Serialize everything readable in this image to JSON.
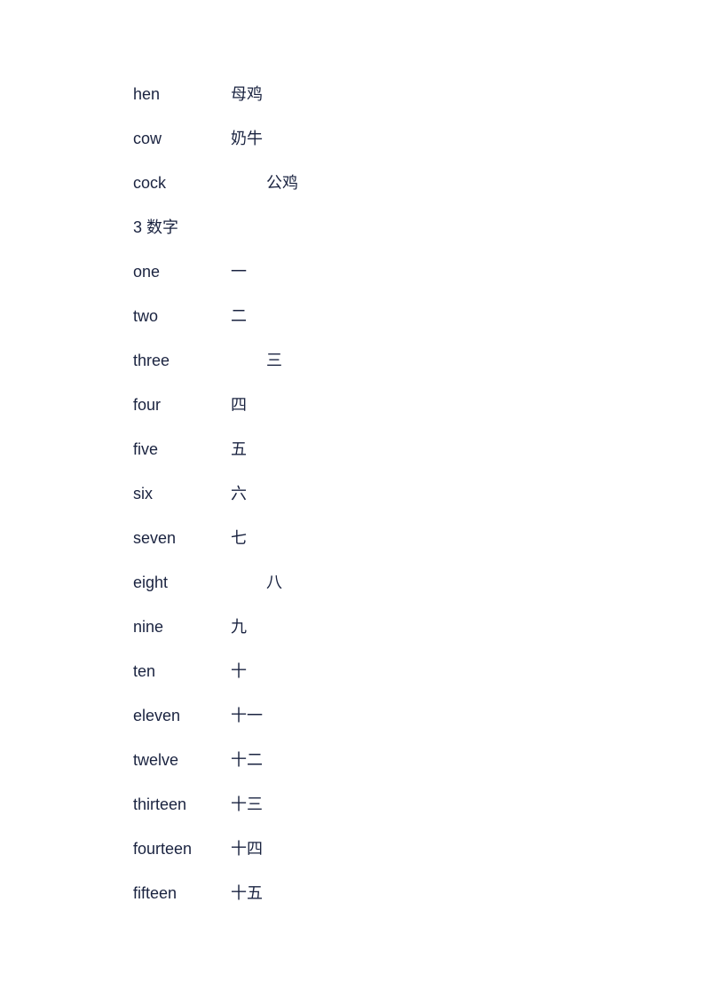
{
  "vocab": [
    {
      "english": "hen",
      "chinese": "母鸡",
      "indent": false
    },
    {
      "english": "cow",
      "chinese": "奶牛",
      "indent": false
    },
    {
      "english": "cock",
      "chinese": "公鸡",
      "indent": true
    }
  ],
  "section": {
    "label": "3 数字"
  },
  "numbers": [
    {
      "english": "one",
      "chinese": "一",
      "indent": false
    },
    {
      "english": "two",
      "chinese": "二",
      "indent": false
    },
    {
      "english": "three",
      "chinese": "三",
      "indent": true
    },
    {
      "english": "four",
      "chinese": "四",
      "indent": false
    },
    {
      "english": "five",
      "chinese": "五",
      "indent": false
    },
    {
      "english": "six",
      "chinese": "六",
      "indent": false
    },
    {
      "english": "seven",
      "chinese": "七",
      "indent": false
    },
    {
      "english": "eight",
      "chinese": "八",
      "indent": true
    },
    {
      "english": "nine",
      "chinese": "九",
      "indent": false
    },
    {
      "english": "ten",
      "chinese": "十",
      "indent": false
    },
    {
      "english": "eleven",
      "chinese": "十一",
      "indent": false
    },
    {
      "english": "twelve",
      "chinese": "十二",
      "indent": false
    },
    {
      "english": "thirteen",
      "chinese": "十三",
      "indent": false
    },
    {
      "english": "fourteen",
      "chinese": "十四",
      "indent": false
    },
    {
      "english": "fifteen",
      "chinese": "十五",
      "indent": false
    }
  ]
}
